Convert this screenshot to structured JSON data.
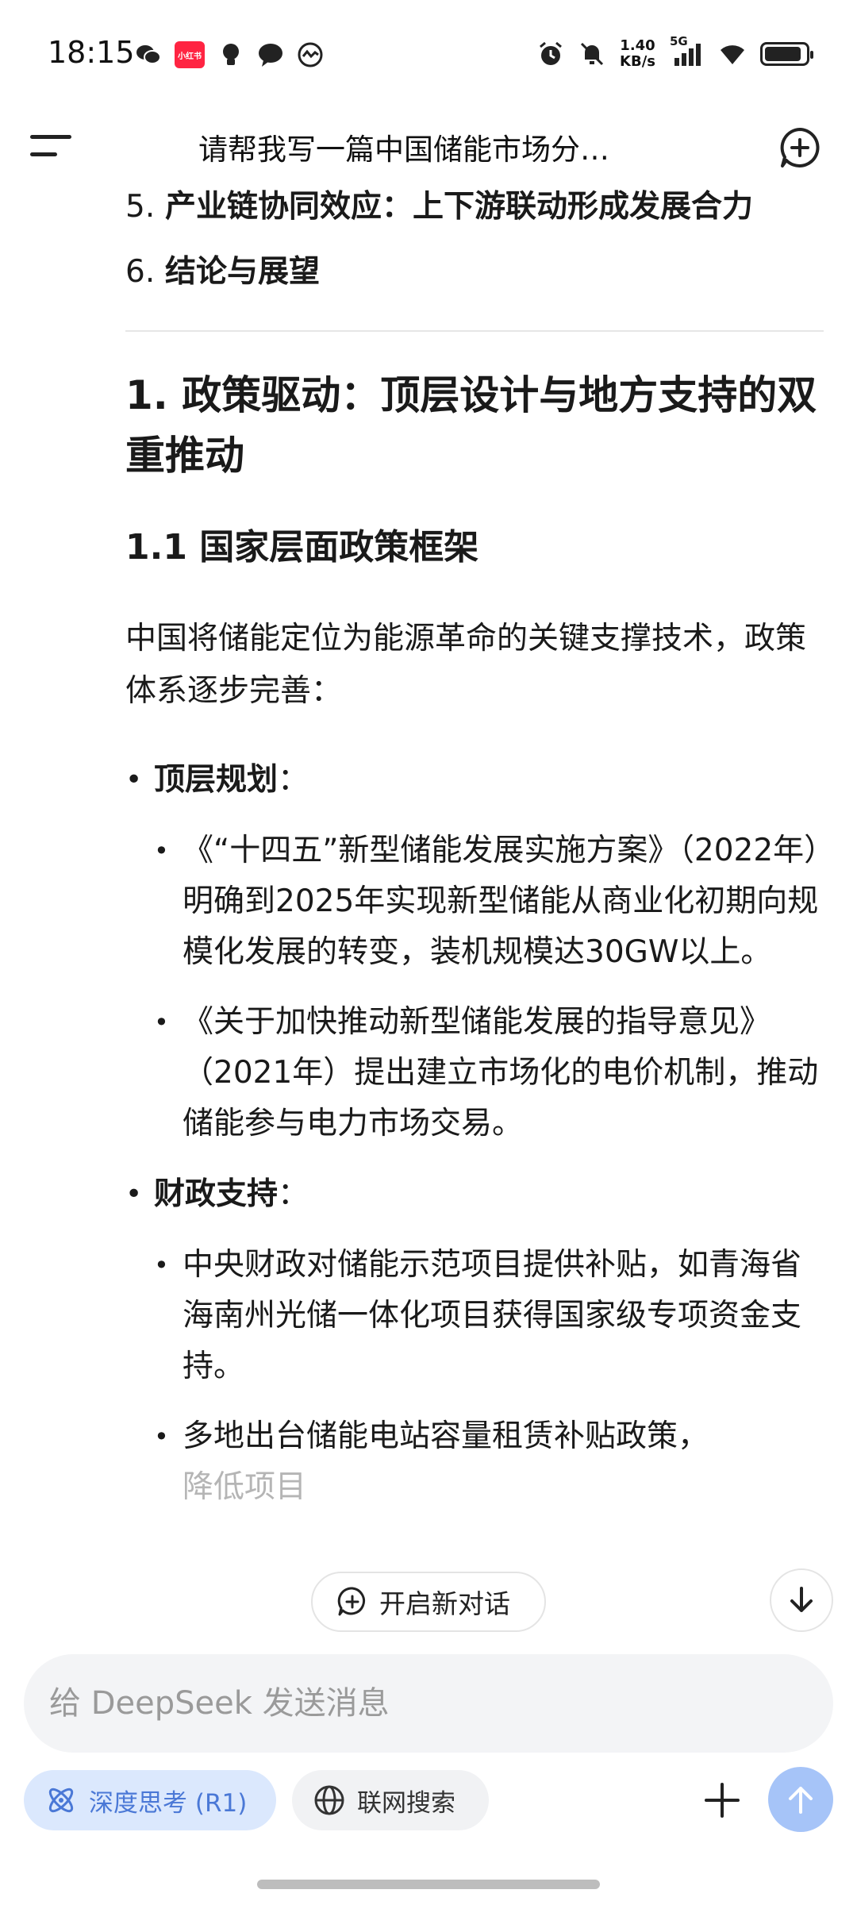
{
  "status_bar": {
    "time": "18:15",
    "app_icon_label": "小红书",
    "net_speed_value": "1.40",
    "net_speed_unit": "KB/s",
    "signal_label": "5G",
    "battery_level": 0.9
  },
  "header": {
    "title": "请帮我写一篇中国储能市场分…"
  },
  "content": {
    "outline": [
      {
        "num": "5.",
        "text": "产业链协同效应：上下游联动形成发展合力"
      },
      {
        "num": "6.",
        "text": "结论与展望"
      }
    ],
    "section_title": "1. 政策驱动：顶层设计与地方支持的双重推动",
    "subsection_title": "1.1 国家层面政策框架",
    "intro": "中国将储能定位为能源革命的关键支撑技术，政策体系逐步完善：",
    "bullets": [
      {
        "label": "顶层规划",
        "colon": "：",
        "items": [
          "《“十四五”新型储能发展实施方案》（2022年）明确到2025年实现新型储能从商业化初期向规模化发展的转变，装机规模达30GW以上。",
          "《关于加快推动新型储能发展的指导意见》（2021年）提出建立市场化的电价机制，推动储能参与电力市场交易。"
        ]
      },
      {
        "label": "财政支持",
        "colon": "：",
        "items": [
          "中央财政对储能示范项目提供补贴，如青海省海南州光储一体化项目获得国家级专项资金支持。"
        ],
        "partial_item_line1": "多地出台储能电站容量租赁补贴政策，",
        "partial_item_line2": "降低项目"
      }
    ]
  },
  "floating": {
    "new_chat_label": "开启新对话"
  },
  "composer": {
    "placeholder": "给 DeepSeek 发送消息"
  },
  "toolbar": {
    "deep_think_label": "深度思考 (R1)",
    "web_search_label": "联网搜索"
  },
  "colors": {
    "accent": "#4a78d6",
    "accent_bg": "#dbe8fd",
    "send_button": "#a6c4f8"
  }
}
